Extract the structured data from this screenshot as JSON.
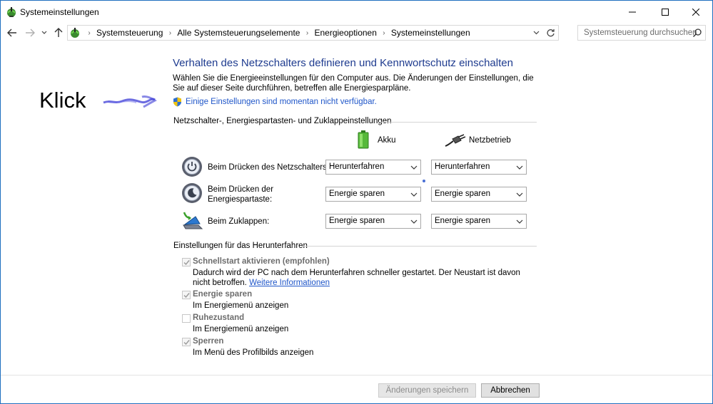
{
  "window": {
    "title": "Systemeinstellungen"
  },
  "nav": {
    "breadcrumbs": [
      "Systemsteuerung",
      "Alle Systemsteuerungselemente",
      "Energieoptionen",
      "Systemeinstellungen"
    ],
    "search_placeholder": "Systemsteuerung durchsuchen"
  },
  "annotation": {
    "text": "Klick"
  },
  "main": {
    "title": "Verhalten des Netzschalters definieren und Kennwortschutz einschalten",
    "description": "Wählen Sie die Energieeinstellungen für den Computer aus. Die Änderungen der Einstellungen, die Sie auf dieser Seite durchführen, betreffen alle Energiesparpläne.",
    "unavailable_link": "Einige Einstellungen sind momentan nicht verfügbar."
  },
  "buttons_section": {
    "heading": "Netzschalter-, Energiespartasten- und Zuklappeinstellungen",
    "col_battery": "Akku",
    "col_ac": "Netzbetrieb",
    "rows": [
      {
        "label": "Beim Drücken des Netzschalters:",
        "battery": "Herunterfahren",
        "ac": "Herunterfahren"
      },
      {
        "label": "Beim Drücken der Energiespartaste:",
        "battery": "Energie sparen",
        "ac": "Energie sparen"
      },
      {
        "label": "Beim Zuklappen:",
        "battery": "Energie sparen",
        "ac": "Energie sparen"
      }
    ]
  },
  "shutdown_section": {
    "heading": "Einstellungen für das Herunterfahren",
    "items": [
      {
        "label": "Schnellstart aktivieren (empfohlen)",
        "checked": true,
        "desc": "Dadurch wird der PC nach dem Herunterfahren schneller gestartet. Der Neustart ist davon nicht betroffen.",
        "link": "Weitere Informationen"
      },
      {
        "label": "Energie sparen",
        "checked": true,
        "desc": "Im Energiemenü anzeigen"
      },
      {
        "label": "Ruhezustand",
        "checked": false,
        "desc": "Im Energiemenü anzeigen"
      },
      {
        "label": "Sperren",
        "checked": true,
        "desc": "Im Menü des Profilbilds anzeigen"
      }
    ]
  },
  "footer": {
    "save_label": "Änderungen speichern",
    "cancel_label": "Abbrechen"
  },
  "colors": {
    "title_blue": "#1e3b8f",
    "link_blue": "#1f56c9",
    "window_border": "#1f6fbf"
  }
}
